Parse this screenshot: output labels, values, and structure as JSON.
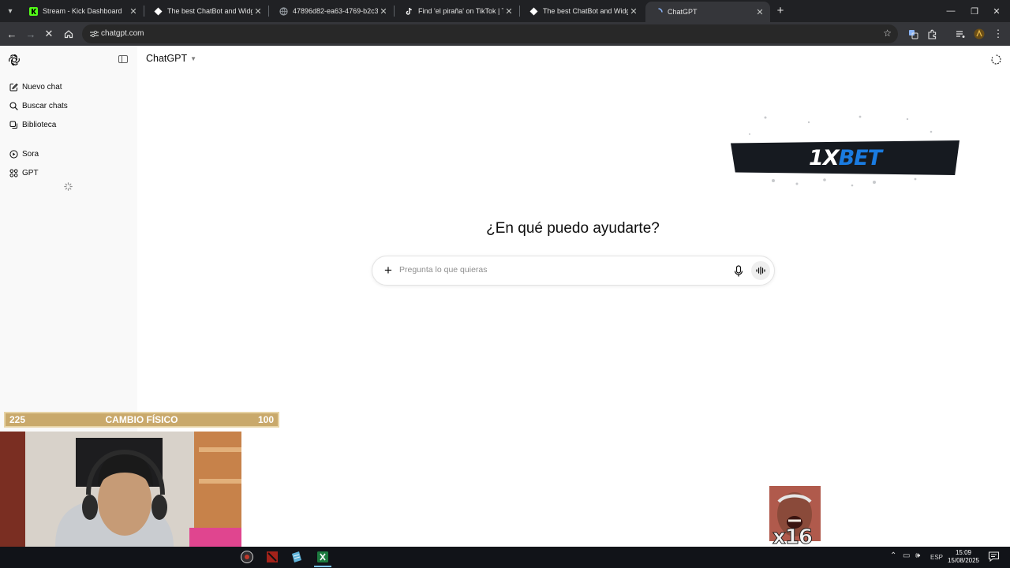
{
  "browser": {
    "tabs": [
      {
        "title": "Stream - Kick Dashboard",
        "icon": "kick-logo-icon"
      },
      {
        "title": "The best ChatBot and Widgets",
        "icon": "botrix-logo-icon"
      },
      {
        "title": "47896d82-ea63-4769-b2c3-27",
        "icon": "globe-icon"
      },
      {
        "title": "Find 'el piraña' on TikTok | TikTo",
        "icon": "tiktok-logo-icon"
      },
      {
        "title": "The best ChatBot and Widgets",
        "icon": "botrix-logo-icon"
      },
      {
        "title": "ChatGPT",
        "icon": "loading-icon",
        "active": true
      }
    ],
    "address": "chatgpt.com"
  },
  "sidebar": {
    "items": [
      {
        "label": "Nuevo chat",
        "icon": "compose-icon"
      },
      {
        "label": "Buscar chats",
        "icon": "search-icon"
      },
      {
        "label": "Biblioteca",
        "icon": "library-icon"
      },
      {
        "label": "Sora",
        "icon": "play-circle-icon"
      },
      {
        "label": "GPT",
        "icon": "grid-icon"
      }
    ]
  },
  "main": {
    "model_selector": "ChatGPT",
    "heading": "¿En qué puedo ayudarte?",
    "composer": {
      "placeholder": "Pregunta lo que quieras",
      "value": ""
    }
  },
  "overlays": {
    "sponsor": {
      "prefix": "1X",
      "suffix": "BET"
    },
    "goal": {
      "left": "225",
      "label": "CAMBIO FÍSICO",
      "right": "100"
    },
    "meme_count": "x16"
  },
  "taskbar": {
    "language": "ESP",
    "time": "15:09",
    "date": "15/08/2025"
  },
  "colors": {
    "accent": "#1a7be0",
    "goal_bar": "#c9a96b",
    "sidebar_bg": "#f9f9f9"
  }
}
